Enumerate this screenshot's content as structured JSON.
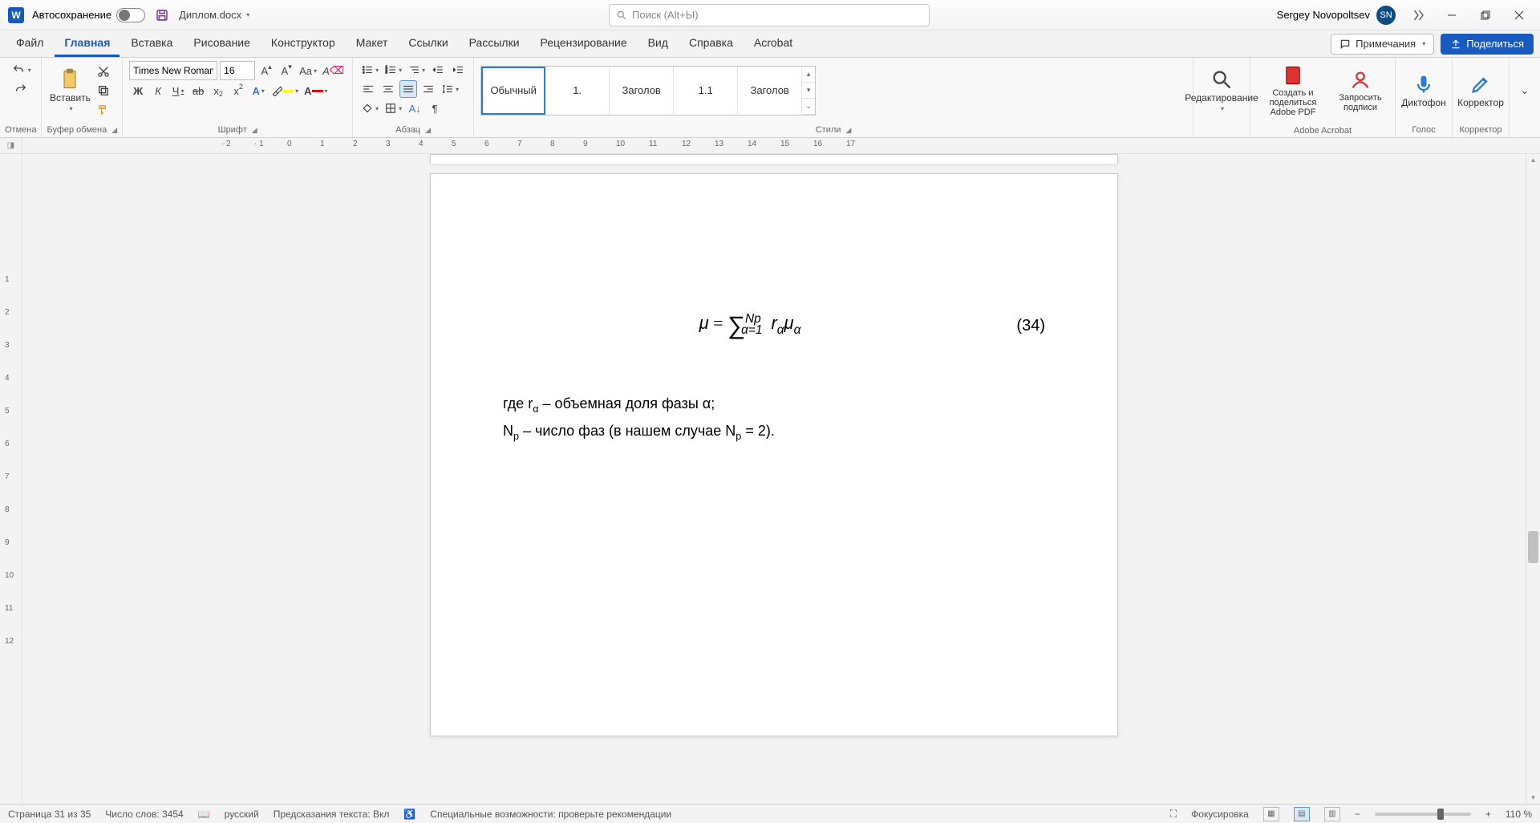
{
  "title_bar": {
    "autosave_label": "Автосохранение",
    "doc_name": "Диплом.docx",
    "search_placeholder": "Поиск (Alt+Ы)",
    "user_name": "Sergey Novopoltsev",
    "user_initials": "SN"
  },
  "tabs": {
    "items": [
      "Файл",
      "Главная",
      "Вставка",
      "Рисование",
      "Конструктор",
      "Макет",
      "Ссылки",
      "Рассылки",
      "Рецензирование",
      "Вид",
      "Справка",
      "Acrobat"
    ],
    "active": 1,
    "comments_label": "Примечания",
    "share_label": "Поделиться"
  },
  "ribbon": {
    "groups": {
      "undo": "Отмена",
      "clipboard": "Буфер обмена",
      "font": "Шрифт",
      "paragraph": "Абзац",
      "styles": "Стили",
      "editing": "Редактирование",
      "acrobat": "Adobe Acrobat",
      "voice": "Голос",
      "corrector": "Корректор"
    },
    "clipboard_paste": "Вставить",
    "font_name": "Times New Roman",
    "font_size": "16",
    "style_items": [
      "Обычный",
      "1.",
      "Заголов",
      "1.1",
      "Заголов"
    ],
    "editing_label": "Редактирование",
    "acrobat_create": "Создать и поделиться Adobe PDF",
    "acrobat_sign": "Запросить подписи",
    "voice_label": "Диктофон",
    "corrector_label": "Корректор"
  },
  "document": {
    "equation_number": "(34)",
    "line1_pre": "где r",
    "line1_sub": "α",
    "line1_post": " – объемная доля фазы α;",
    "line2_a": "N",
    "line2_a_sub": "p",
    "line2_b": " – число фаз (в нашем случае N",
    "line2_b_sub": "p",
    "line2_c": " = 2)."
  },
  "status": {
    "page": "Страница 31 из 35",
    "words": "Число слов: 3454",
    "language": "русский",
    "predictions": "Предсказания текста: Вкл",
    "accessibility": "Специальные возможности: проверьте рекомендации",
    "focus": "Фокусировка",
    "zoom": "110 %"
  }
}
